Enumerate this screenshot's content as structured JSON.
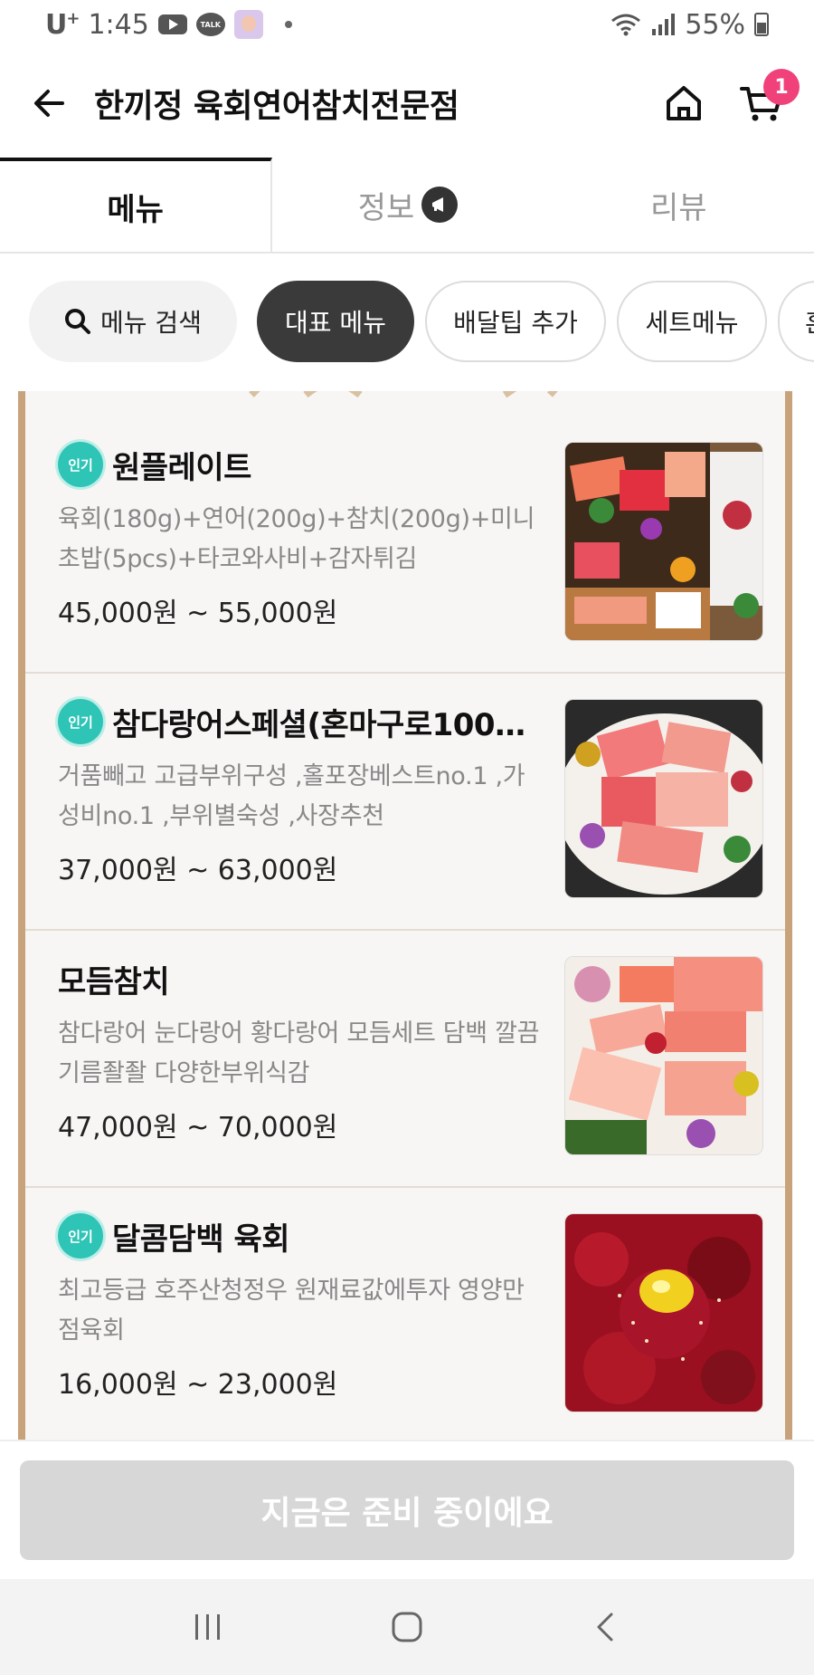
{
  "status_bar": {
    "carrier": "U",
    "carrier_sup": "+",
    "time": "1:45",
    "talk_label": "TALK",
    "battery": "55%"
  },
  "header": {
    "title": "한끼정 육회연어참치전문점",
    "cart_count": "1"
  },
  "tabs": [
    {
      "label": "메뉴",
      "active": true
    },
    {
      "label": "정보",
      "active": false
    },
    {
      "label": "리뷰",
      "active": false
    }
  ],
  "chips": {
    "search_label": "메뉴 검색",
    "items": [
      {
        "label": "대표 메뉴"
      },
      {
        "label": "배달팁 추가"
      },
      {
        "label": "세트메뉴"
      },
      {
        "label": "혼"
      }
    ]
  },
  "menu": {
    "popular_label": "인기",
    "items": [
      {
        "name": "원플레이트",
        "popular": true,
        "desc": "육회(180g)+연어(200g)+참치(200g)+미니초밥(5pcs)+타코와사비+감자튀김",
        "price": "45,000원 ~ 55,000원"
      },
      {
        "name": "참다랑어스페셜(혼마구로100…",
        "popular": true,
        "desc": "거품빼고 고급부위구성 ,홀포장베스트no.1 ,가성비no.1 ,부위별숙성 ,사장추천",
        "price": "37,000원 ~ 63,000원"
      },
      {
        "name": "모듬참치",
        "popular": false,
        "desc": "참다랑어 눈다랑어 황다랑어 모듬세트 담백 깔끔 기름좔좔 다양한부위식감",
        "price": "47,000원 ~ 70,000원"
      },
      {
        "name": "달콤담백 육회",
        "popular": true,
        "desc": "최고등급 호주산청정우 원재료값에투자 영양만점육회",
        "price": "16,000원 ~ 23,000원"
      }
    ]
  },
  "bottom": {
    "order_button_label": "지금은 준비 중이에요"
  },
  "colors": {
    "badge_pink": "#f0417a",
    "popular_teal": "#2ec4b6",
    "frame_gold": "#c7a27a",
    "disabled_button": "#d7d7d7"
  }
}
